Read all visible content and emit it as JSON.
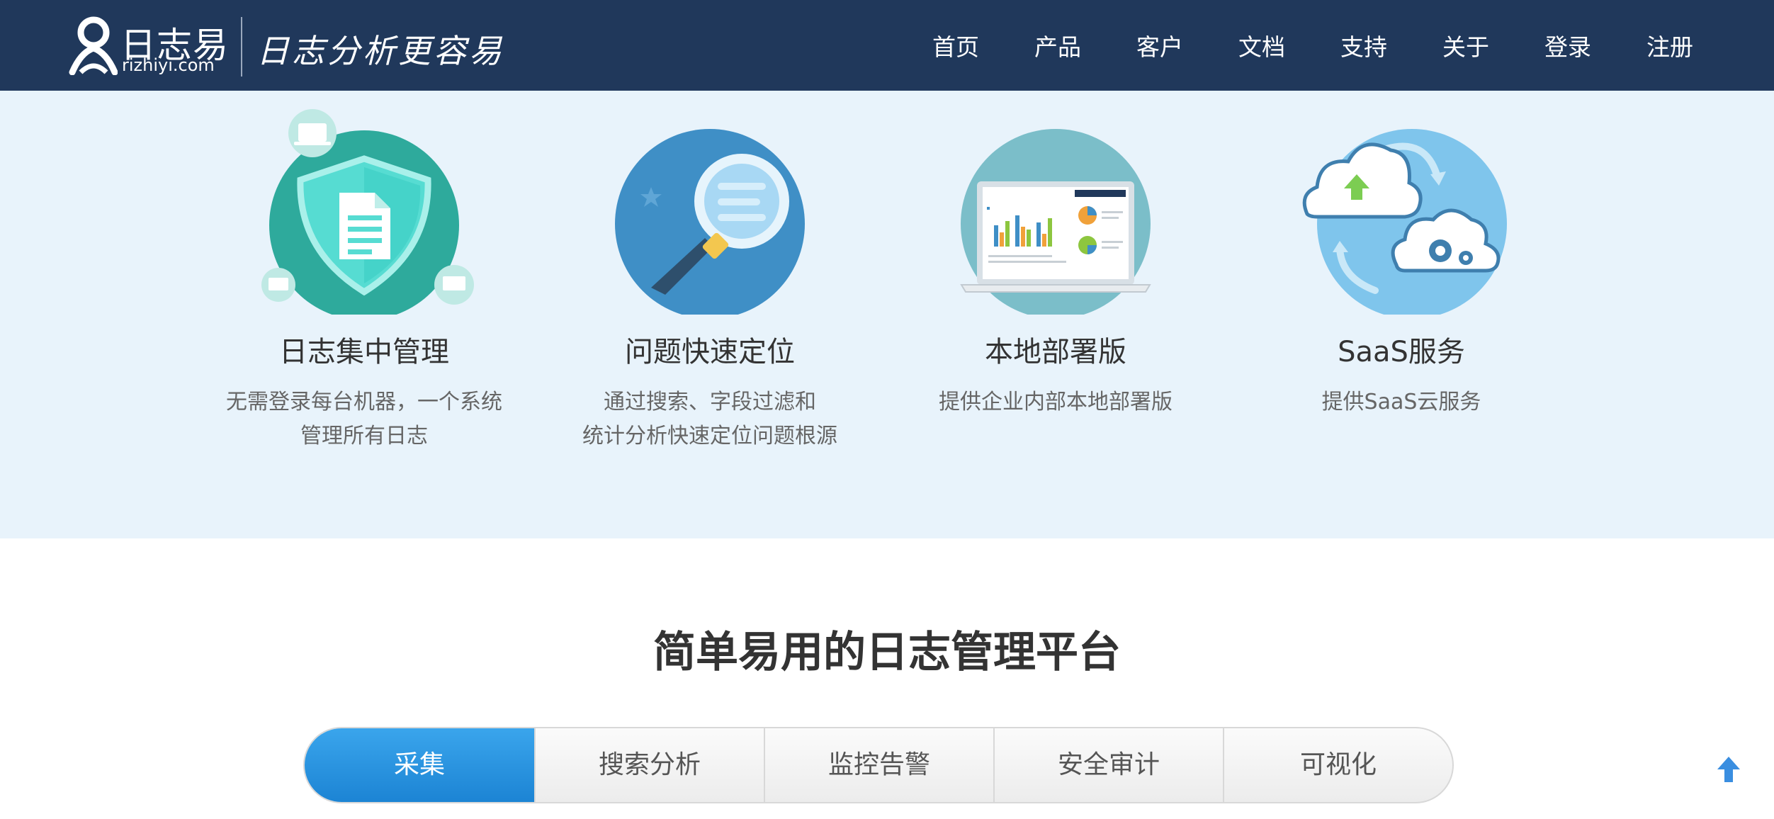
{
  "brand": {
    "name_cn": "日志易",
    "domain": "rizhiyi.com",
    "slogan": "日志分析更容易"
  },
  "nav": {
    "items": [
      "首页",
      "产品",
      "客户",
      "文档",
      "支持",
      "关于",
      "登录",
      "注册"
    ]
  },
  "features": [
    {
      "title": "日志集中管理",
      "desc": [
        "无需登录每台机器，一个系统",
        "管理所有日志"
      ],
      "icon": "shield-document-icon"
    },
    {
      "title": "问题快速定位",
      "desc": [
        "通过搜索、字段过滤和",
        "统计分析快速定位问题根源"
      ],
      "icon": "magnifier-icon"
    },
    {
      "title": "本地部署版",
      "desc": [
        "提供企业内部本地部署版"
      ],
      "icon": "laptop-dashboard-icon"
    },
    {
      "title": "SaaS服务",
      "desc": [
        "提供SaaS云服务"
      ],
      "icon": "cloud-upload-icon"
    }
  ],
  "platform": {
    "title": "简单易用的日志管理平台",
    "tabs": [
      "采集",
      "搜索分析",
      "监控告警",
      "安全审计",
      "可视化"
    ],
    "active_tab": "采集"
  },
  "colors": {
    "header_bg": "#20385b",
    "band_bg": "#e8f3fb",
    "accent": "#1c84d4"
  },
  "icons": {
    "back_to_top": "arrow-up-icon"
  }
}
